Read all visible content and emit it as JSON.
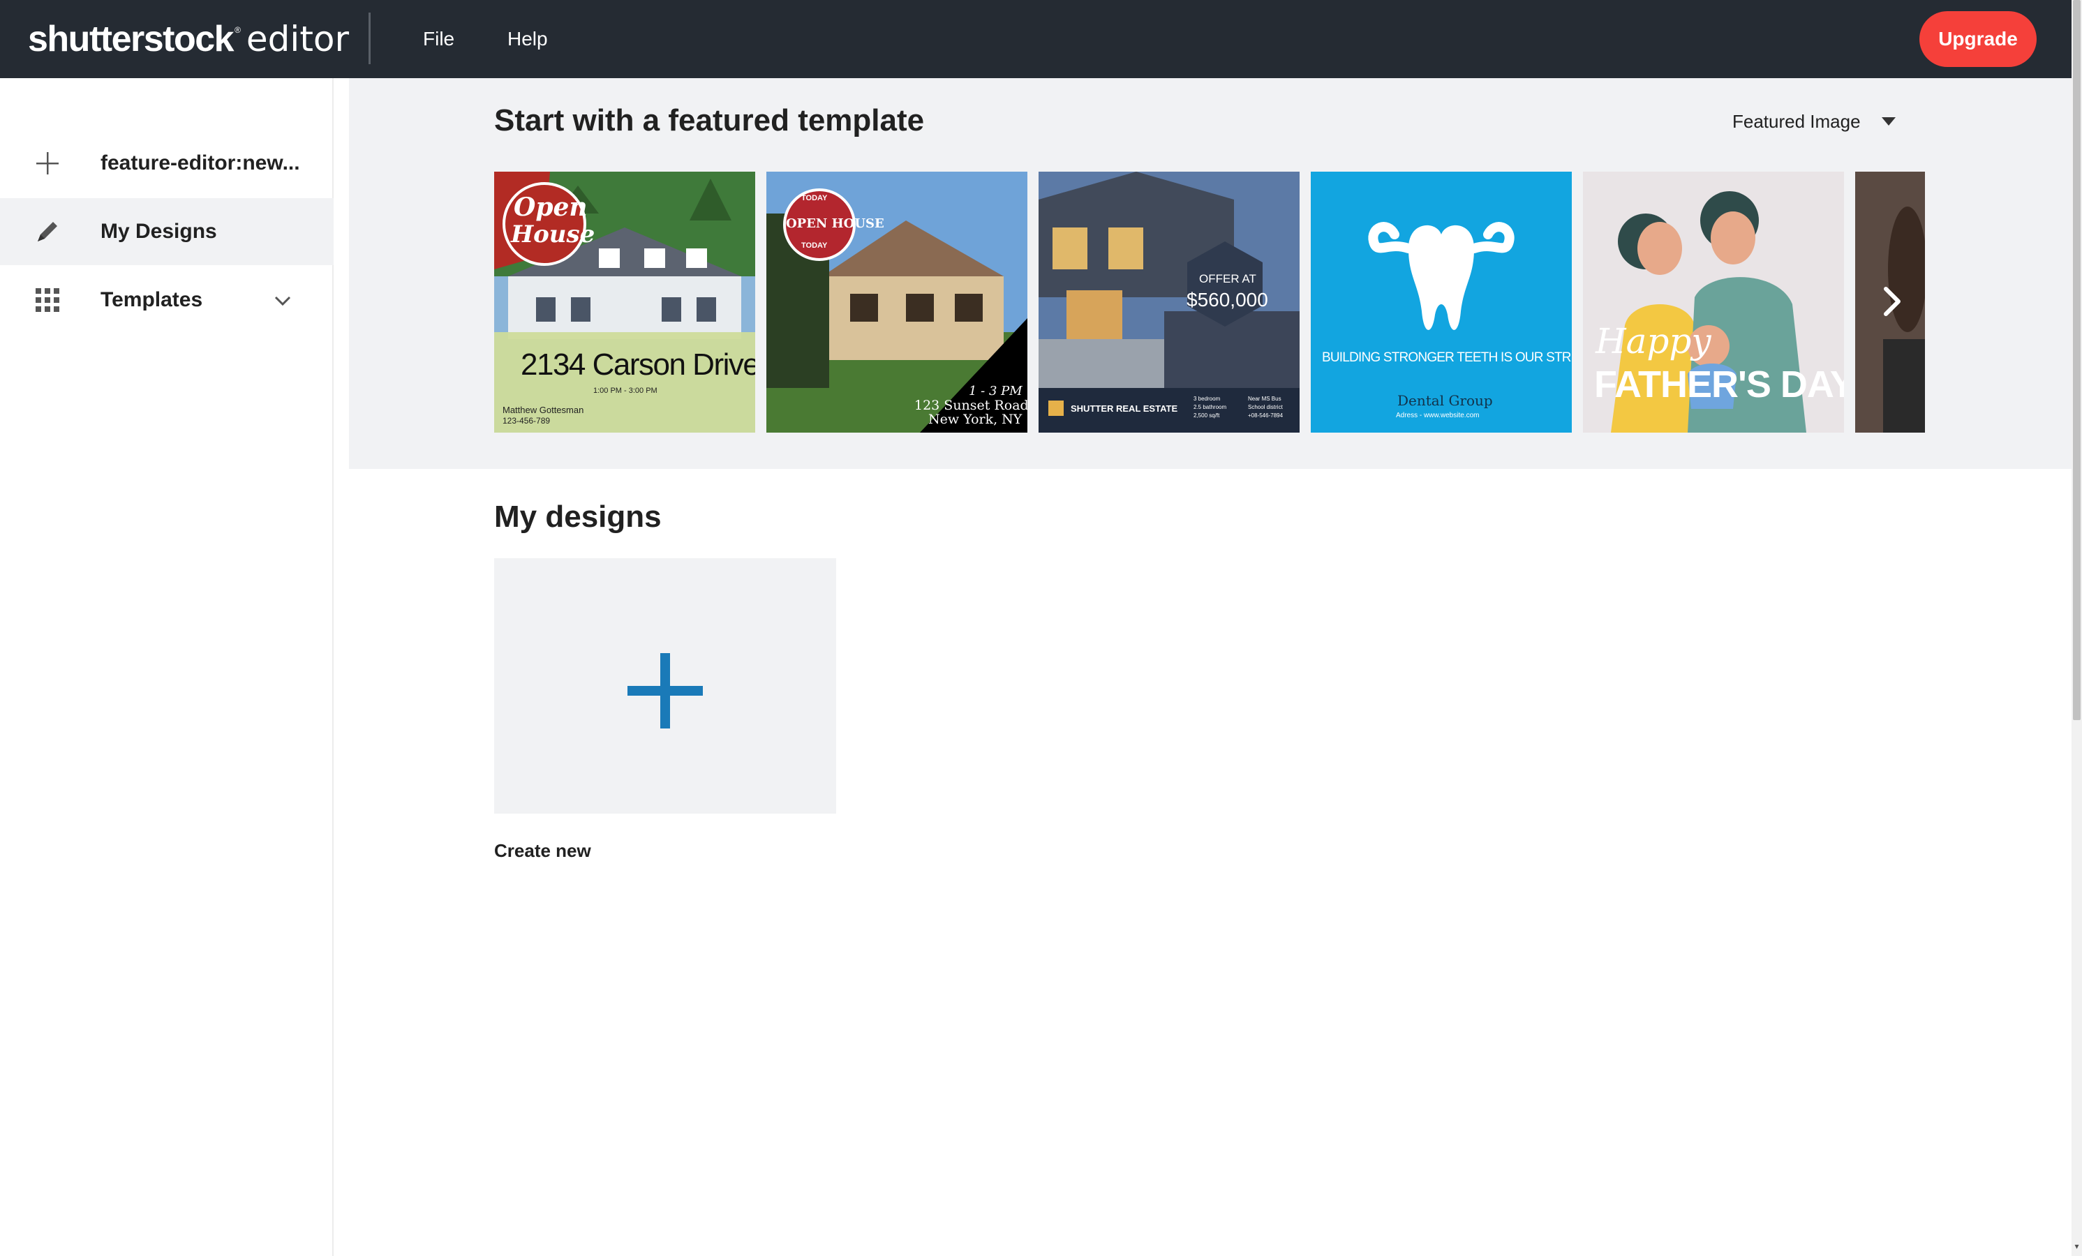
{
  "app": {
    "logo_main": "shutterstock",
    "logo_sub": "editor",
    "logo_mark": "®"
  },
  "menu": {
    "file": "File",
    "help": "Help"
  },
  "upgrade_label": "Upgrade",
  "sidebar": {
    "items": [
      {
        "label": "feature-editor:new...",
        "icon": "plus-icon",
        "active": false
      },
      {
        "label": "My Designs",
        "icon": "pencil-icon",
        "active": true
      },
      {
        "label": "Templates",
        "icon": "grid-icon",
        "active": false,
        "expandable": true
      }
    ]
  },
  "featured": {
    "title": "Start with a featured template",
    "size_selected": "Featured Image"
  },
  "templates": [
    {
      "name": "open-house-carson",
      "badge_line1": "Open",
      "badge_line2": "House",
      "address": "2134 Carson Drive",
      "time": "1:00 PM - 3:00 PM",
      "agent": "Matthew Gottesman",
      "phone": "123-456-789"
    },
    {
      "name": "open-house-sunset",
      "badge_top": "TODAY",
      "badge_mid": "OPEN HOUSE",
      "badge_bottom": "TODAY",
      "time": "1 - 3 PM",
      "street": "123 Sunset Road",
      "city": "New York, NY"
    },
    {
      "name": "offer-real-estate",
      "offer_label": "OFFER AT",
      "price": "$560,000",
      "company": "SHUTTER REAL ESTATE",
      "features_left": [
        "3 bedroom",
        "2.5 bathroom",
        "2,500 sq/ft"
      ],
      "features_right": [
        "Near MS Bus",
        "School district",
        "+08-546-7894"
      ]
    },
    {
      "name": "dental-group",
      "headline": "BUILDING STRONGER TEETH IS OUR STRENGTH",
      "brand": "Dental Group",
      "contact": "Adress - www.website.com"
    },
    {
      "name": "fathers-day",
      "line1": "Happy",
      "line2": "FATHER'S DAY"
    }
  ],
  "my_designs": {
    "title": "My designs",
    "create_label": "Create new"
  },
  "colors": {
    "topbar": "#252b33",
    "upgrade": "#f5403a",
    "accent_plus": "#1a7ab8",
    "panel_bg": "#f1f2f4",
    "dental_blue": "#12a5e0"
  }
}
